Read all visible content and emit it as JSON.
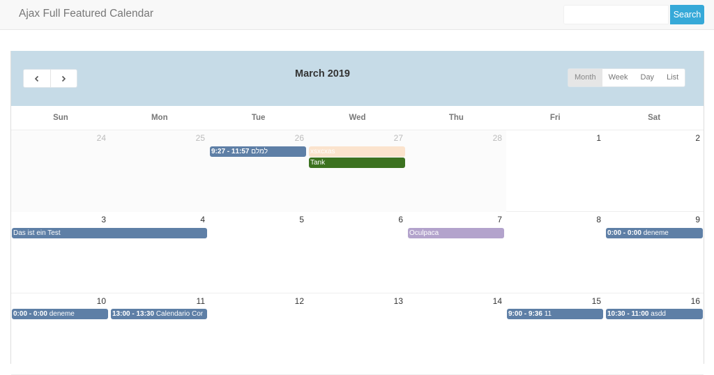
{
  "app": {
    "title": "Ajax Full Featured Calendar",
    "search_placeholder": "",
    "search_button": "Search"
  },
  "calendar": {
    "title": "March 2019",
    "prev_icon": "chevron-left-icon",
    "next_icon": "chevron-right-icon",
    "views": [
      "Month",
      "Week",
      "Day",
      "List"
    ],
    "active_view": "Month",
    "weekdays": [
      "Sun",
      "Mon",
      "Tue",
      "Wed",
      "Thu",
      "Fri",
      "Sat"
    ],
    "weeks": [
      [
        "24",
        "25",
        "26",
        "27",
        "28",
        "1",
        "2"
      ],
      [
        "3",
        "4",
        "5",
        "6",
        "7",
        "8",
        "9"
      ],
      [
        "10",
        "11",
        "12",
        "13",
        "14",
        "15",
        "16"
      ]
    ],
    "events": {
      "e1": {
        "time": "9:27 - 11:57",
        "title": "למלם",
        "color": "#5e7fa6"
      },
      "e2": {
        "time": "",
        "title": "xsxcxas",
        "color": "#fbe3cd"
      },
      "e3": {
        "time": "",
        "title": "Tank",
        "color": "#3c7220"
      },
      "e4": {
        "time": "",
        "title": "Das ist ein Test",
        "color": "#5e7fa6"
      },
      "e5": {
        "time": "",
        "title": "Oculpaca",
        "color": "#b3a3cc"
      },
      "e6": {
        "time": "0:00 - 0:00",
        "title": "deneme",
        "color": "#5e7fa6"
      },
      "e7": {
        "time": "0:00 - 0:00",
        "title": "deneme",
        "color": "#5e7fa6"
      },
      "e8": {
        "time": "13:00 - 13:30",
        "title": "Calendario Cor",
        "color": "#5e7fa6"
      },
      "e9": {
        "time": "9:00 - 9:36",
        "title": "11",
        "color": "#5e7fa6"
      },
      "e10": {
        "time": "10:30 - 11:00",
        "title": "asdd",
        "color": "#5e7fa6"
      }
    }
  }
}
